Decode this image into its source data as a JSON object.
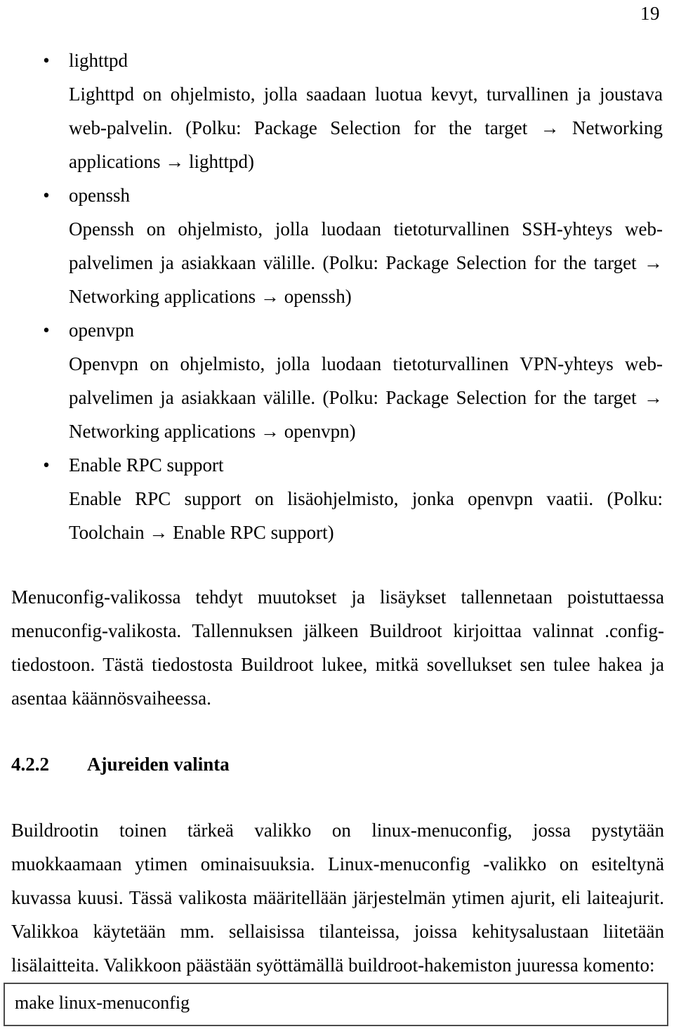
{
  "page": {
    "number": "19",
    "language": "fi"
  },
  "arrow_glyph": "→",
  "bullets": [
    {
      "label": "lighttpd",
      "body_before_arrow1": "Lighttpd on ohjelmisto, jolla saadaan luotua kevyt, turvallinen ja joustava web-palvelin. (Polku: Package Selection for the target ",
      "body_mid": " Networking applications ",
      "body_end": " lighttpd)",
      "full_text": "Lighttpd on ohjelmisto, jolla saadaan luotua kevyt, turvallinen ja joustava web-palvelin. (Polku: Package Selection for the target → Networking applications → lighttpd)"
    },
    {
      "label": "openssh",
      "full_text": "Openssh on ohjelmisto, jolla luodaan tietoturvallinen SSH-yhteys web-palvelimen ja asiakkaan välille. (Polku: Package Selection for the target → Networking applications → openssh)"
    },
    {
      "label": "openvpn",
      "full_text": "Openvpn on ohjelmisto, jolla luodaan tietoturvallinen VPN-yhteys web-palvelimen ja asiakkaan välille. (Polku: Package Selection for the target → Networking applications → openvpn)"
    },
    {
      "label": "Enable RPC support",
      "full_text": "Enable RPC support on lisäohjelmisto, jonka openvpn vaatii. (Polku: Toolchain → Enable RPC support)"
    }
  ],
  "paragraphs": {
    "after_bullets": "Menuconfig-valikossa tehdyt muutokset ja lisäykset tallennetaan poistuttaessa menuconfig-valikosta. Tallennuksen jälkeen Buildroot kirjoittaa valinnat .config-tiedostoon. Tästä tiedostosta Buildroot lukee, mitkä sovellukset sen tulee hakea ja asentaa käännösvaiheessa.",
    "after_heading": "Buildrootin toinen tärkeä valikko on linux-menuconfig, jossa pystytään muokkaamaan ytimen ominaisuuksia. Linux-menuconfig -valikko on esiteltynä kuvassa kuusi. Tässä valikosta määritellään järjestelmän ytimen ajurit, eli laiteajurit. Valikkoa käytetään mm. sellaisissa tilanteissa, joissa kehitysalustaan liitetään lisälaitteita. Valikkoon päästään syöttämällä buildroot-hakemiston juuressa komento:"
  },
  "heading": {
    "number": "4.2.2",
    "title": "Ajureiden valinta"
  },
  "code_box": {
    "command": "make linux-menuconfig"
  },
  "colors": {
    "text": "#000000",
    "background": "#ffffff",
    "code_box_border": "#4a4a4a"
  }
}
